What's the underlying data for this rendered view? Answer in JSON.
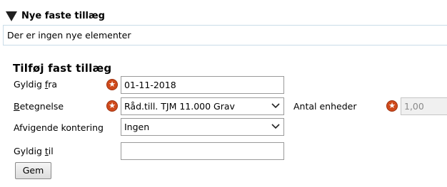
{
  "section": {
    "title": "Nye faste tillæg",
    "empty_message": "Der er ingen nye elementer"
  },
  "form": {
    "title": "Tilføj fast tillæg",
    "gyldig_fra": {
      "label_pre": "Gyldig ",
      "label_key": "f",
      "label_post": "ra",
      "value": "01-11-2018"
    },
    "betegnelse": {
      "label_pre": "",
      "label_key": "B",
      "label_post": "etegnelse",
      "value": "Råd.till. TJM 11.000 Grav"
    },
    "antal_enheder": {
      "label": "Antal enheder",
      "value": "1,00"
    },
    "afvigende_kontering": {
      "label": "Afvigende kontering",
      "value": "Ingen"
    },
    "gyldig_til": {
      "label_pre": "Gyldig ",
      "label_key": "t",
      "label_post": "il",
      "value": ""
    },
    "required_icon": "star-icon",
    "save_label": "Gem"
  }
}
